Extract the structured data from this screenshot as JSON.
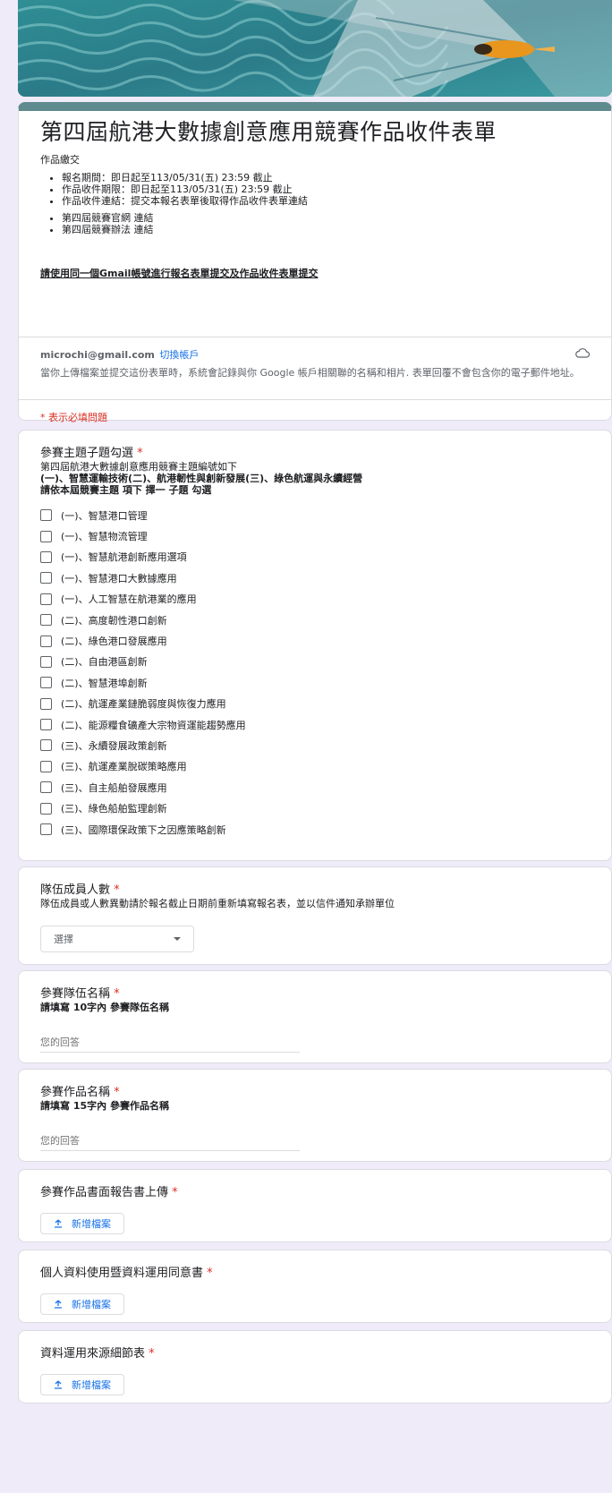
{
  "header": {
    "title": "第四屆航港大數據創意應用競賽作品收件表單",
    "section_label": "作品繳交",
    "bullets_1": [
      "報名期間：即日起至113/05/31(五) 23:59 截止",
      "作品收件期限：即日起至113/05/31(五) 23:59 截止",
      "作品收件連結：提交本報名表單後取得作品收件表單連結"
    ],
    "bullets_2": [
      "第四屆競賽官網 連結",
      "第四屆競賽辦法 連結"
    ],
    "gmail_notice": "請使用同一個Gmail帳號進行報名表單提交及作品收件表單提交",
    "account_email": "microchi@gmail.com",
    "switch_account": "切換帳戶",
    "record_notice": "當你上傳檔案並提交這份表單時，系統會記錄與你 Google 帳戶相關聯的名稱和相片. 表單回覆不會包含你的電子郵件地址。",
    "required_note": "* 表示必填問題"
  },
  "q1": {
    "title": "參賽主題子題勾選",
    "required_mark": "*",
    "desc_1": "第四屆航港大數據創意應用競賽主題編號如下",
    "desc_2": "(一)、智慧運輸技術(二)、航港韌性與創新發展(三)、綠色航運與永續經營",
    "desc_3": "請依本屆競賽主題 項下 擇一 子題 勾選",
    "options": [
      "(一)、智慧港口管理",
      "(一)、智慧物流管理",
      "(一)、智慧航港創新應用選項",
      "(一)、智慧港口大數據應用",
      "(一)、人工智慧在航港業的應用",
      "(二)、高度韌性港口創新",
      "(二)、綠色港口發展應用",
      "(二)、自由港區創新",
      "(二)、智慧港埠創新",
      "(二)、航運產業鏈脆弱度與恢復力應用",
      "(二)、能源糧食礦產大宗物資運能趨勢應用",
      "(三)、永續發展政策創新",
      "(三)、航運產業脫碳策略應用",
      "(三)、自主船舶發展應用",
      "(三)、綠色船舶監理創新",
      "(三)、國際環保政策下之因應策略創新"
    ]
  },
  "q2": {
    "title": "隊伍成員人數",
    "required_mark": "*",
    "desc": "隊伍成員或人數異動請於報名截止日期前重新填寫報名表，並以信件通知承辦單位",
    "select_value": "選擇"
  },
  "q3": {
    "title": "參賽隊伍名稱",
    "required_mark": "*",
    "desc": "請填寫 10字內 參賽隊伍名稱",
    "placeholder": "您的回答"
  },
  "q4": {
    "title": "參賽作品名稱",
    "required_mark": "*",
    "desc": "請填寫 15字內 參賽作品名稱",
    "placeholder": "您的回答"
  },
  "q5": {
    "title": "參賽作品書面報告書上傳",
    "required_mark": "*",
    "button": "新增檔案"
  },
  "q6": {
    "title": "個人資料使用暨資料運用同意書",
    "required_mark": "*",
    "button": "新增檔案"
  },
  "q7": {
    "title": "資料運用來源細節表",
    "required_mark": "*",
    "button": "新增檔案"
  },
  "colors": {
    "accent": "#5f8a8e",
    "link": "#1a73e8",
    "required": "#d93025",
    "background": "#f0ebf8"
  }
}
